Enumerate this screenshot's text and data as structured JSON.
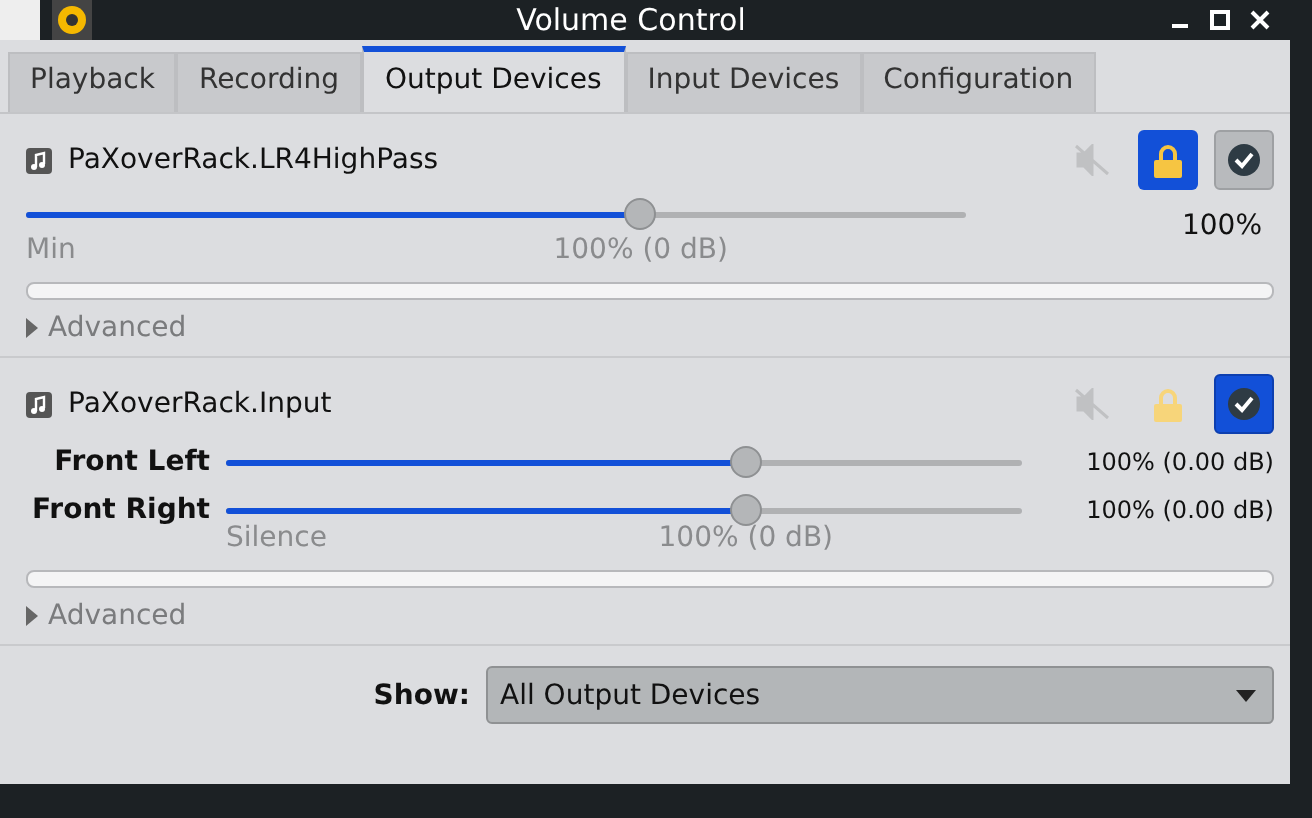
{
  "window": {
    "title": "Volume Control"
  },
  "tabs": [
    {
      "label": "Playback",
      "selected": false
    },
    {
      "label": "Recording",
      "selected": false
    },
    {
      "label": "Output Devices",
      "selected": true
    },
    {
      "label": "Input Devices",
      "selected": false
    },
    {
      "label": "Configuration",
      "selected": false
    }
  ],
  "devices": [
    {
      "kind": "merged",
      "name": "PaXoverRack.LR4HighPass",
      "muted": false,
      "locked": true,
      "default": false,
      "reading": "100%",
      "scale": {
        "min": "Min",
        "mark": "100% (0 dB)"
      },
      "channels": [
        {
          "level": 0.654
        }
      ],
      "advanced": {
        "label": "Advanced",
        "expanded": false
      }
    },
    {
      "kind": "split",
      "name": "PaXoverRack.Input",
      "muted": false,
      "locked": false,
      "default": true,
      "scale": {
        "min": "Silence",
        "mark": "100% (0 dB)"
      },
      "channels": [
        {
          "label": "Front Left",
          "level": 0.653,
          "reading": "100% (0.00 dB)"
        },
        {
          "label": "Front Right",
          "level": 0.653,
          "reading": "100% (0.00 dB)"
        }
      ],
      "advanced": {
        "label": "Advanced",
        "expanded": false
      }
    }
  ],
  "show": {
    "label": "Show:",
    "value": "All Output Devices"
  }
}
